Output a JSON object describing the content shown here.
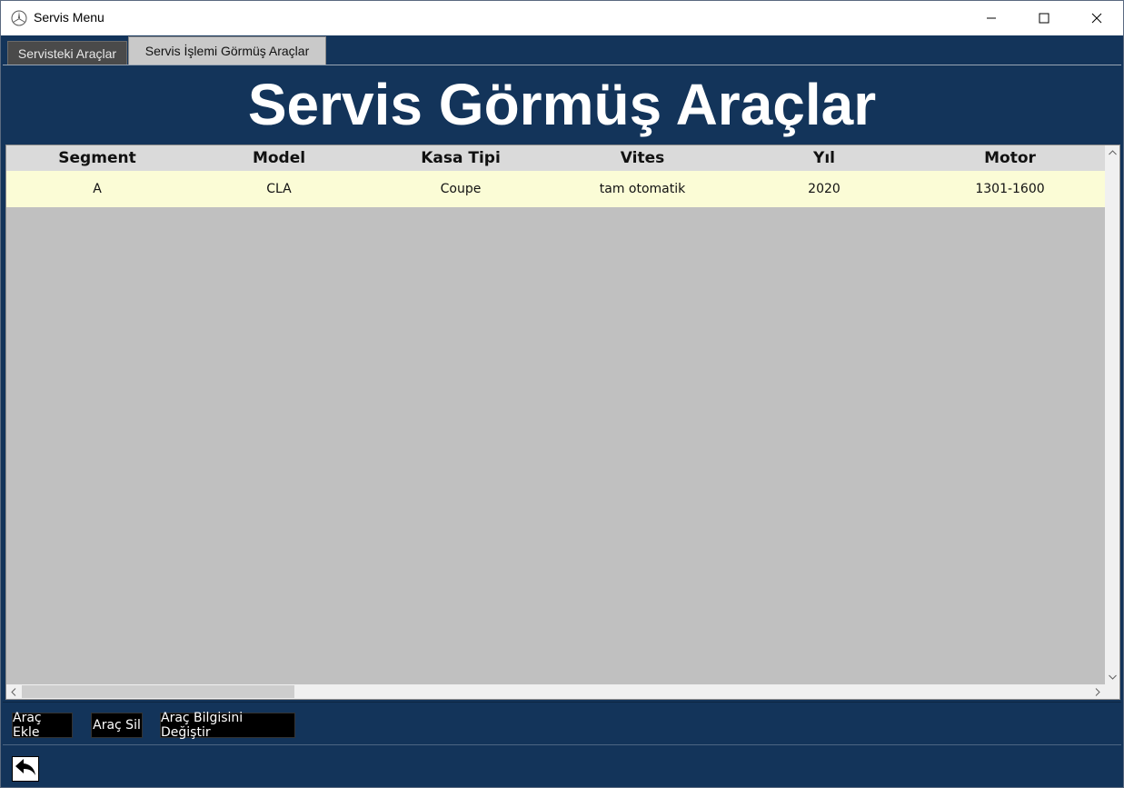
{
  "window": {
    "title": "Servis Menu",
    "icons": {
      "app": "mercedes-star-icon",
      "minimize": "minimize-icon",
      "maximize": "maximize-icon",
      "close": "close-icon"
    }
  },
  "tabs": [
    {
      "label": "Servisteki Araçlar",
      "selected": false
    },
    {
      "label": "Servis İşlemi Görmüş Araçlar",
      "selected": true
    }
  ],
  "page": {
    "heading": "Servis Görmüş Araçlar"
  },
  "grid": {
    "columns": [
      "Segment",
      "Model",
      "Kasa Tipi",
      "Vites",
      "Yıl",
      "Motor"
    ],
    "rows": [
      [
        "A",
        "CLA",
        "Coupe",
        "tam otomatik",
        "2020",
        "1301-1600"
      ]
    ]
  },
  "actions": {
    "add": "Araç Ekle",
    "delete": "Araç Sil",
    "edit": "Araç Bilgisini Değiştir"
  },
  "nav": {
    "back_icon": "back-arrow-icon"
  },
  "colors": {
    "background": "#13345a",
    "grid_body": "#c0c0c0",
    "row_highlight": "#fbfcd6",
    "header": "#dadada"
  }
}
